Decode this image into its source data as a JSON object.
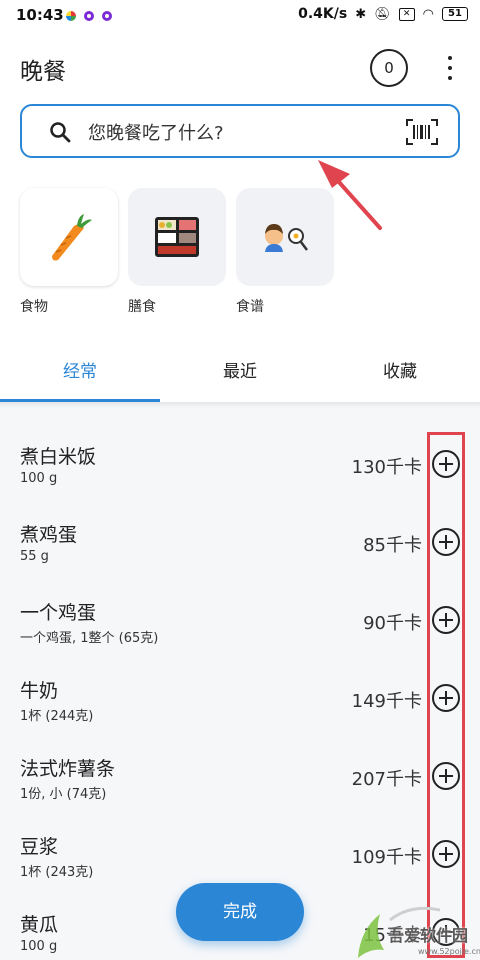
{
  "status_bar": {
    "time": "10:43",
    "network_speed": "0.4K/s",
    "battery": "51",
    "icons": [
      "bluetooth-icon",
      "mute-icon",
      "sim-icon",
      "wifi-icon",
      "battery-icon"
    ]
  },
  "header": {
    "title": "晚餐",
    "count": "0"
  },
  "search": {
    "placeholder": "您晚餐吃了什么?"
  },
  "categories": [
    {
      "label": "食物",
      "icon": "carrot-icon"
    },
    {
      "label": "膳食",
      "icon": "bento-icon"
    },
    {
      "label": "食谱",
      "icon": "cook-icon"
    }
  ],
  "tabs": [
    {
      "label": "经常",
      "active": true
    },
    {
      "label": "最近",
      "active": false
    },
    {
      "label": "收藏",
      "active": false
    }
  ],
  "foods": [
    {
      "name": "煮白米饭",
      "serving": "100 g",
      "kcal": "130千卡"
    },
    {
      "name": "煮鸡蛋",
      "serving": "55 g",
      "kcal": "85千卡"
    },
    {
      "name": "一个鸡蛋",
      "serving": "一个鸡蛋, 1整个 (65克)",
      "kcal": "90千卡"
    },
    {
      "name": "牛奶",
      "serving": "1杯 (244克)",
      "kcal": "149千卡"
    },
    {
      "name": "法式炸薯条",
      "serving": "1份, 小 (74克)",
      "kcal": "207千卡"
    },
    {
      "name": "豆浆",
      "serving": "1杯 (243克)",
      "kcal": "109千卡"
    },
    {
      "name": "黄瓜",
      "serving": "100 g",
      "kcal": "15千卡"
    }
  ],
  "done_button": "完成",
  "watermark": {
    "text": "吾爱软件园",
    "url": "www.52pojie.cn"
  },
  "colors": {
    "accent": "#2b86d6",
    "annotation": "#e0444e"
  }
}
